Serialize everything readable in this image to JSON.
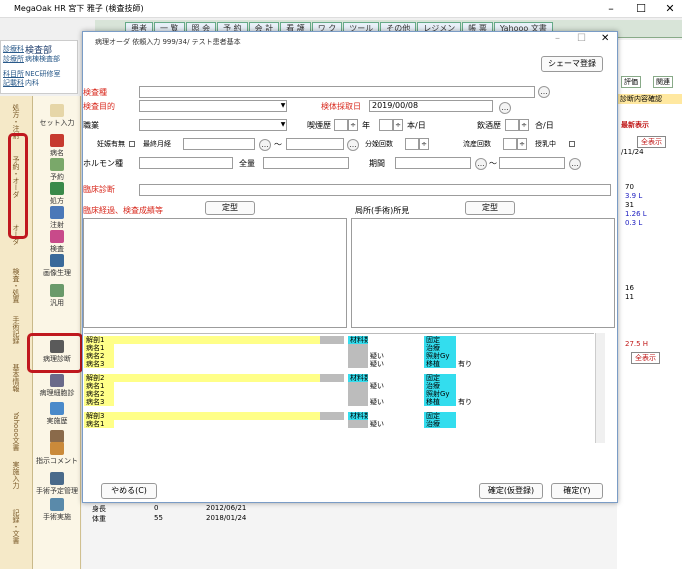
{
  "app": {
    "title": "MegaOak HR 宮下 雅子 (検査技師)",
    "minimize": "–",
    "maximize": "☐",
    "close": "✕"
  },
  "topmenu": {
    "home": "患者",
    "items": [
      "一 覧",
      "照 会",
      "予 約",
      "会 計",
      "看 護",
      "ワ ク",
      "ツール",
      "その他",
      "レジメン",
      "帳 票",
      "Yahooo 文書"
    ]
  },
  "patient": {
    "link1": "診療科",
    "name": "検査部",
    "label2": "診療所",
    "sub1": "病棟検査部",
    "label3": "科目所",
    "sub2": "NEC研修室",
    "label4": "記載科",
    "sub3": "内科"
  },
  "sidebar": {
    "tabs": [
      "処方・注射",
      "予約・オーダ",
      "オーダ",
      "検査・処置",
      "手術記録",
      "基本情報",
      "Yahooo文書",
      "実施入力",
      "記録・文書"
    ],
    "items": [
      "セット入力",
      "病名",
      "予約",
      "処方",
      "注射",
      "検査",
      "画像生理",
      "汎用",
      "病理診断",
      "病理細胞診",
      "実施歴",
      "ハリ",
      "指示コメント",
      "手術予定管理",
      "手術実施"
    ]
  },
  "rightpanel": {
    "btn1": "評価",
    "btn2": "関連",
    "label": "診断内容確認",
    "latest": "最新表示",
    "showall": "全表示",
    "date": "/11/24",
    "vals": [
      "70",
      "3.9 L",
      "31",
      "1.26 L",
      "0.3 L",
      "16",
      "11",
      "27.5 H"
    ],
    "showall2": "全表示"
  },
  "bottombg": {
    "rows": [
      {
        "k": "身長",
        "v": "0",
        "d": "2012/06/21"
      },
      {
        "k": "体重",
        "v": "55",
        "d": "2018/01/24"
      }
    ]
  },
  "dialog": {
    "title": "病理オーダ 依頼入力 999/34/ テスト患者基本",
    "schema_button": "シェーマ登録",
    "specimen_label": "検査種",
    "purpose_label": "検査目的",
    "collect_date_label": "検体採取日",
    "collect_date": "2019/00/08",
    "job_label": "職業",
    "smoking_label": "喫煙歴",
    "year_unit": "年",
    "perday_unit": "本/日",
    "drinking_label": "飲酒歴",
    "gou_unit": "合/日",
    "pregnant_label": "妊娠有無",
    "lmp_label": "最終月経",
    "tilde": "～",
    "delivery_label": "分娩回数",
    "abortion_label": "流産回数",
    "lactating_label": "授乳中",
    "hormone_label": "ホルモン種",
    "total_label": "全量",
    "period_label": "期間",
    "clinical_diag_label": "臨床診断",
    "clinical_course_label": "臨床経過、検査成績等",
    "local_findings_label": "局所(手術)所見",
    "template_button": "定型",
    "template_button2": "定型",
    "grid_rows": [
      {
        "type": "part",
        "label": "解剖1",
        "mid": "材料数",
        "fix_label": "固定"
      },
      {
        "type": "dis",
        "label": "病名1",
        "mid": "",
        "chk": "",
        "right_label": "治療"
      },
      {
        "type": "dis",
        "label": "病名2",
        "mid": "",
        "chk": "疑い",
        "right_label": "照射Gy"
      },
      {
        "type": "dis",
        "label": "病名3",
        "mid": "",
        "chk": "疑い",
        "right_label": "移植",
        "right_chk": "有り"
      },
      {
        "type": "gap"
      },
      {
        "type": "part",
        "label": "解剖2",
        "mid": "材料数",
        "fix_label": "固定"
      },
      {
        "type": "dis",
        "label": "病名1",
        "mid": "",
        "chk": "疑い",
        "right_label": "治療"
      },
      {
        "type": "dis",
        "label": "病名2",
        "mid": "",
        "chk": "",
        "right_label": "照射Gy"
      },
      {
        "type": "dis",
        "label": "病名3",
        "mid": "",
        "chk": "疑い",
        "right_label": "移植",
        "right_chk": "有り"
      },
      {
        "type": "gap"
      },
      {
        "type": "part",
        "label": "解剖3",
        "mid": "材料数",
        "fix_label": "固定"
      },
      {
        "type": "dis",
        "label": "病名1",
        "mid": "",
        "chk": "疑い",
        "right_label": "治療"
      }
    ],
    "cancel_button": "やめる(C)",
    "confirm_temp_button": "確定(仮登録)",
    "confirm_button": "確定(Y)"
  },
  "colors": {
    "highlight": "#c0181e",
    "yellow_row": "#ffff88",
    "cyan_cell": "#33ddee",
    "label_red": "#d8281c"
  }
}
